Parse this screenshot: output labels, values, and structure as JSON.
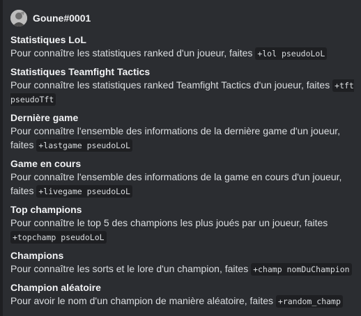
{
  "embed": {
    "author": {
      "name": "Goune#0001"
    },
    "fields": [
      {
        "name": "Statistiques LoL",
        "text": "Pour connaître les statistiques ranked d'un joueur, faites ",
        "code": "+lol pseudoLoL"
      },
      {
        "name": "Statistiques Teamfight Tactics",
        "text": "Pour connaître les statistiques ranked Teamfight Tactics d'un joueur, faites ",
        "code": "+tft pseudoTft"
      },
      {
        "name": "Dernière game",
        "text": "Pour connaître l'ensemble des informations de la dernière game d'un joueur, faites ",
        "code": "+lastgame pseudoLoL"
      },
      {
        "name": "Game en cours",
        "text": "Pour connaître l'ensemble des informations de la game en cours d'un joueur, faites ",
        "code": "+livegame pseudoLoL"
      },
      {
        "name": "Top champions",
        "text": "Pour connaître le top 5 des champions les plus joués par un joueur, faites ",
        "code": "+topchamp pseudoLoL"
      },
      {
        "name": "Champions",
        "text": "Pour connaître les sorts et le lore d'un champion, faites ",
        "code": "+champ nomDuChampion"
      },
      {
        "name": "Champion aléatoire",
        "text": "Pour avoir le nom d'un champion de manière aléatoire, faites ",
        "code": "+random_champ"
      }
    ]
  },
  "colors": {
    "background": "#2b2d31",
    "accent_bar": "#1e1f22",
    "title": "#f2f3f5",
    "text": "#dbdee1",
    "code_background": "#1e1f22"
  }
}
